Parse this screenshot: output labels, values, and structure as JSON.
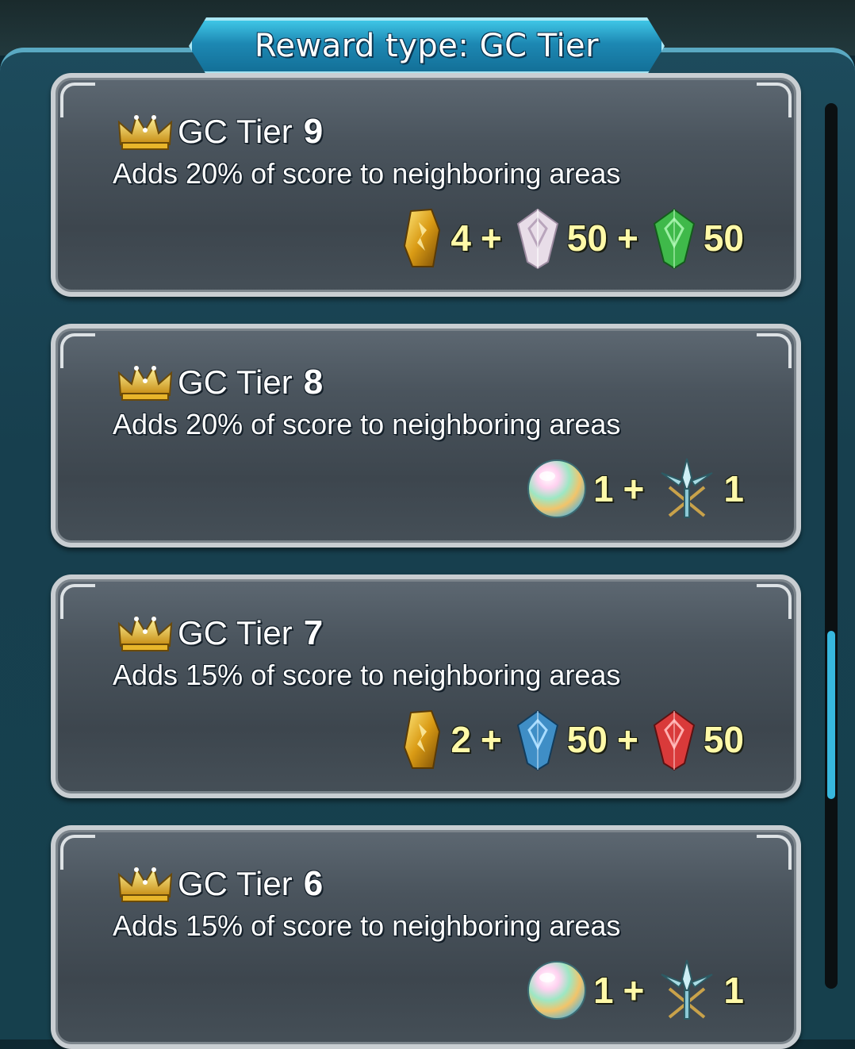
{
  "header": {
    "title": "Reward type: GC Tier"
  },
  "tiers": [
    {
      "label": "GC Tier",
      "number": "9",
      "description": "Adds 20% of score to neighboring areas",
      "rewards": [
        {
          "icon": "grail-icon",
          "amount": "4"
        },
        {
          "icon": "universal-crystal-icon",
          "amount": "50"
        },
        {
          "icon": "green-crystal-icon",
          "amount": "50"
        }
      ]
    },
    {
      "label": "GC Tier",
      "number": "8",
      "description": "Adds 20% of score to neighboring areas",
      "rewards": [
        {
          "icon": "orb-icon",
          "amount": "1"
        },
        {
          "icon": "sword-icon",
          "amount": "1"
        }
      ]
    },
    {
      "label": "GC Tier",
      "number": "7",
      "description": "Adds 15% of score to neighboring areas",
      "rewards": [
        {
          "icon": "grail-icon",
          "amount": "2"
        },
        {
          "icon": "blue-crystal-icon",
          "amount": "50"
        },
        {
          "icon": "red-crystal-icon",
          "amount": "50"
        }
      ]
    },
    {
      "label": "GC Tier",
      "number": "6",
      "description": "Adds 15% of score to neighboring areas",
      "rewards": [
        {
          "icon": "orb-icon",
          "amount": "1"
        },
        {
          "icon": "sword-icon",
          "amount": "1"
        }
      ]
    }
  ],
  "plus_sign": "+",
  "colors": {
    "accent": "#37b7dd",
    "amount_text": "#fff9a8",
    "green_crystal": "#3fb94a",
    "blue_crystal": "#3f8ec6",
    "red_crystal": "#d93a3a",
    "universal_crystal": "#e8dde8",
    "grail": "#e0a920"
  }
}
